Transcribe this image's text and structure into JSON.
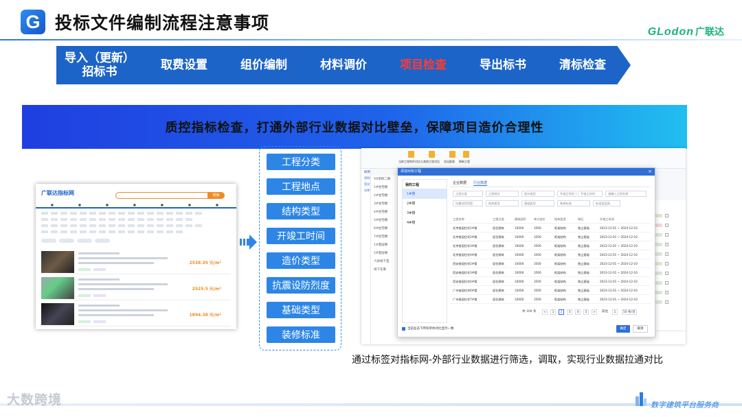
{
  "header": {
    "logo_letter": "G",
    "title": "投标文件编制流程注意事项",
    "brand_en": "GLodon",
    "brand_cn": "广联达",
    "brand_color": "#17b37a"
  },
  "steps": [
    {
      "label": "导入（更新）招标书",
      "active": false
    },
    {
      "label": "取费设置",
      "active": false
    },
    {
      "label": "组价编制",
      "active": false
    },
    {
      "label": "材料调价",
      "active": false
    },
    {
      "label": "项目检查",
      "active": true
    },
    {
      "label": "导出标书",
      "active": false
    },
    {
      "label": "清标检查",
      "active": false
    }
  ],
  "banner": {
    "text": "质控指标检查，打通外部行业数据对比壁垒，保障项目造价合理性"
  },
  "site": {
    "logo": "广联达指标网",
    "search_button": "搜索",
    "projects": [
      {
        "price": "2538.35 元/m²"
      },
      {
        "price": "2525.5 元/m²"
      },
      {
        "price": "1894.38 元/m²"
      }
    ]
  },
  "tags": [
    "工程分类",
    "工程地点",
    "结构类型",
    "开竣工时间",
    "造价类型",
    "抗震设防烈度",
    "基础类型",
    "装修标准"
  ],
  "app": {
    "toolbar": [
      "当前工程构件对比",
      "与其他工程对比",
      "导出报表",
      "刷新工程"
    ],
    "left_labels": [
      "概算",
      "指标",
      "造价",
      "分析"
    ],
    "tree": [
      "XX项目二期",
      "1#住宅楼",
      "2#住宅楼",
      "3#住宅楼",
      "4#住宅楼",
      "5#住宅楼",
      "6#住宅楼",
      "7#住宅楼",
      "1#底层楼",
      "2#底层楼",
      "人防地下室",
      "地下车库"
    ],
    "modal": {
      "title": "添加对标工程",
      "side_header": "我的工程",
      "side_items": [
        "1#楼",
        "2#楼",
        "3#楼",
        "4#楼"
      ],
      "tabs": [
        "企业数据",
        "行业数据"
      ],
      "filters": [
        "工程分类",
        "工程地点",
        "造价类型",
        "开竣工时间",
        "开竣工时间",
        "请输入工程名称",
        "抗震设防烈度",
        "结构类型",
        "基础类型",
        "装修标准",
        "标准层层高"
      ],
      "columns": [
        "工程名称",
        "工程分类",
        "建筑面积",
        "单方造价",
        "结构类型",
        "地区",
        "开竣工时间"
      ],
      "rows": [
        [
          "北京香园住宅1#楼",
          "居住建筑",
          "10000",
          "3500",
          "框架结构",
          "独立基础",
          "2023-12-01 ~ 2024-12-10"
        ],
        [
          "北京香园住宅2#楼",
          "居住建筑",
          "10000",
          "3500",
          "框架结构",
          "独立基础",
          "2023-12-01 ~ 2024-12-10"
        ],
        [
          "北京香园住宅3#楼",
          "居住建筑",
          "10000",
          "3500",
          "框架结构",
          "独立基础",
          "2023-12-01 ~ 2024-12-10"
        ],
        [
          "北京香园住宅4#楼",
          "居住建筑",
          "10000",
          "3500",
          "框架结构",
          "独立基础",
          "2023-12-01 ~ 2024-12-10"
        ],
        [
          "西安香园住宅2#楼",
          "居住建筑",
          "10000",
          "3500",
          "框架结构",
          "独立基础",
          "2023-12-01 ~ 2024-12-10"
        ],
        [
          "西安香园住宅3#楼",
          "居住建筑",
          "10000",
          "3500",
          "框架结构",
          "独立基础",
          "2023-12-01 ~ 2024-12-10"
        ],
        [
          "西安香园住宅4#楼",
          "居住建筑",
          "10000",
          "3500",
          "框架结构",
          "独立基础",
          "2023-12-01 ~ 2024-12-10"
        ],
        [
          "广州香园住宅6#楼",
          "居住建筑",
          "10000",
          "3500",
          "框架结构",
          "独立基础",
          "2023-12-01 ~ 2024-12-10"
        ],
        [
          "广州香园住宅7#楼",
          "居住建筑",
          "10000",
          "3500",
          "框架结构",
          "独立基础",
          "2023-12-01 ~ 2024-12-10"
        ]
      ],
      "pager": [
        "共 100 条",
        "<",
        "1",
        "2",
        "3",
        "4",
        "5",
        ">",
        "前往",
        "1",
        "50 条/页"
      ],
      "footer_check": "当前业态下所有单体对比显示一致",
      "ok": "确定",
      "cancel": "取消"
    }
  },
  "caption": "通过标签对指标网-外部行业数据进行筛选，调取，实现行业数据拉通对比",
  "footer": {
    "watermark": "大数跨境",
    "brand": "数字建筑平台服务商"
  }
}
